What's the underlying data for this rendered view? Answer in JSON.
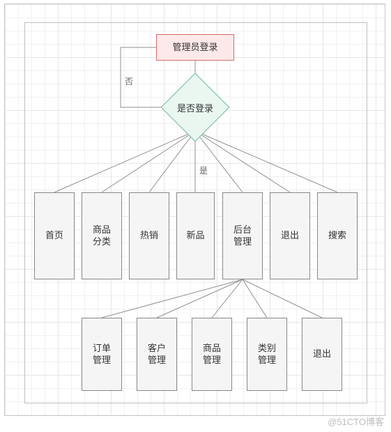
{
  "chart_data": {
    "type": "flowchart",
    "nodes": {
      "start": {
        "text": "管理员登录",
        "shape": "terminator",
        "fill": "#fde9e9"
      },
      "decision": {
        "text": "是否登录",
        "shape": "decision",
        "fill": "#eaf7f1"
      },
      "home": {
        "text": "首页",
        "shape": "process"
      },
      "category": {
        "text": "商品\n分类",
        "shape": "process"
      },
      "hot": {
        "text": "热销",
        "shape": "process"
      },
      "new": {
        "text": "新品",
        "shape": "process"
      },
      "admin": {
        "text": "后台\n管理",
        "shape": "process"
      },
      "logout": {
        "text": "退出",
        "shape": "process"
      },
      "search": {
        "text": "搜索",
        "shape": "process"
      },
      "order": {
        "text": "订单\n管理",
        "shape": "process"
      },
      "customer": {
        "text": "客户\n管理",
        "shape": "process"
      },
      "product": {
        "text": "商品\n管理",
        "shape": "process"
      },
      "catmgmt": {
        "text": "类别\n管理",
        "shape": "process"
      },
      "logout2": {
        "text": "退出",
        "shape": "process"
      }
    },
    "edges": [
      {
        "from": "start",
        "to": "decision",
        "label": ""
      },
      {
        "from": "decision",
        "to": "start",
        "label": "否",
        "path": "loopback"
      },
      {
        "from": "decision",
        "to": "home",
        "label": "是"
      },
      {
        "from": "decision",
        "to": "category"
      },
      {
        "from": "decision",
        "to": "hot"
      },
      {
        "from": "decision",
        "to": "new"
      },
      {
        "from": "decision",
        "to": "admin"
      },
      {
        "from": "decision",
        "to": "logout"
      },
      {
        "from": "decision",
        "to": "search"
      },
      {
        "from": "admin",
        "to": "order"
      },
      {
        "from": "admin",
        "to": "customer"
      },
      {
        "from": "admin",
        "to": "product"
      },
      {
        "from": "admin",
        "to": "catmgmt"
      },
      {
        "from": "admin",
        "to": "logout2"
      }
    ],
    "edge_labels": {
      "no": "否",
      "yes": "是"
    }
  },
  "watermark": "@51CTO博客"
}
